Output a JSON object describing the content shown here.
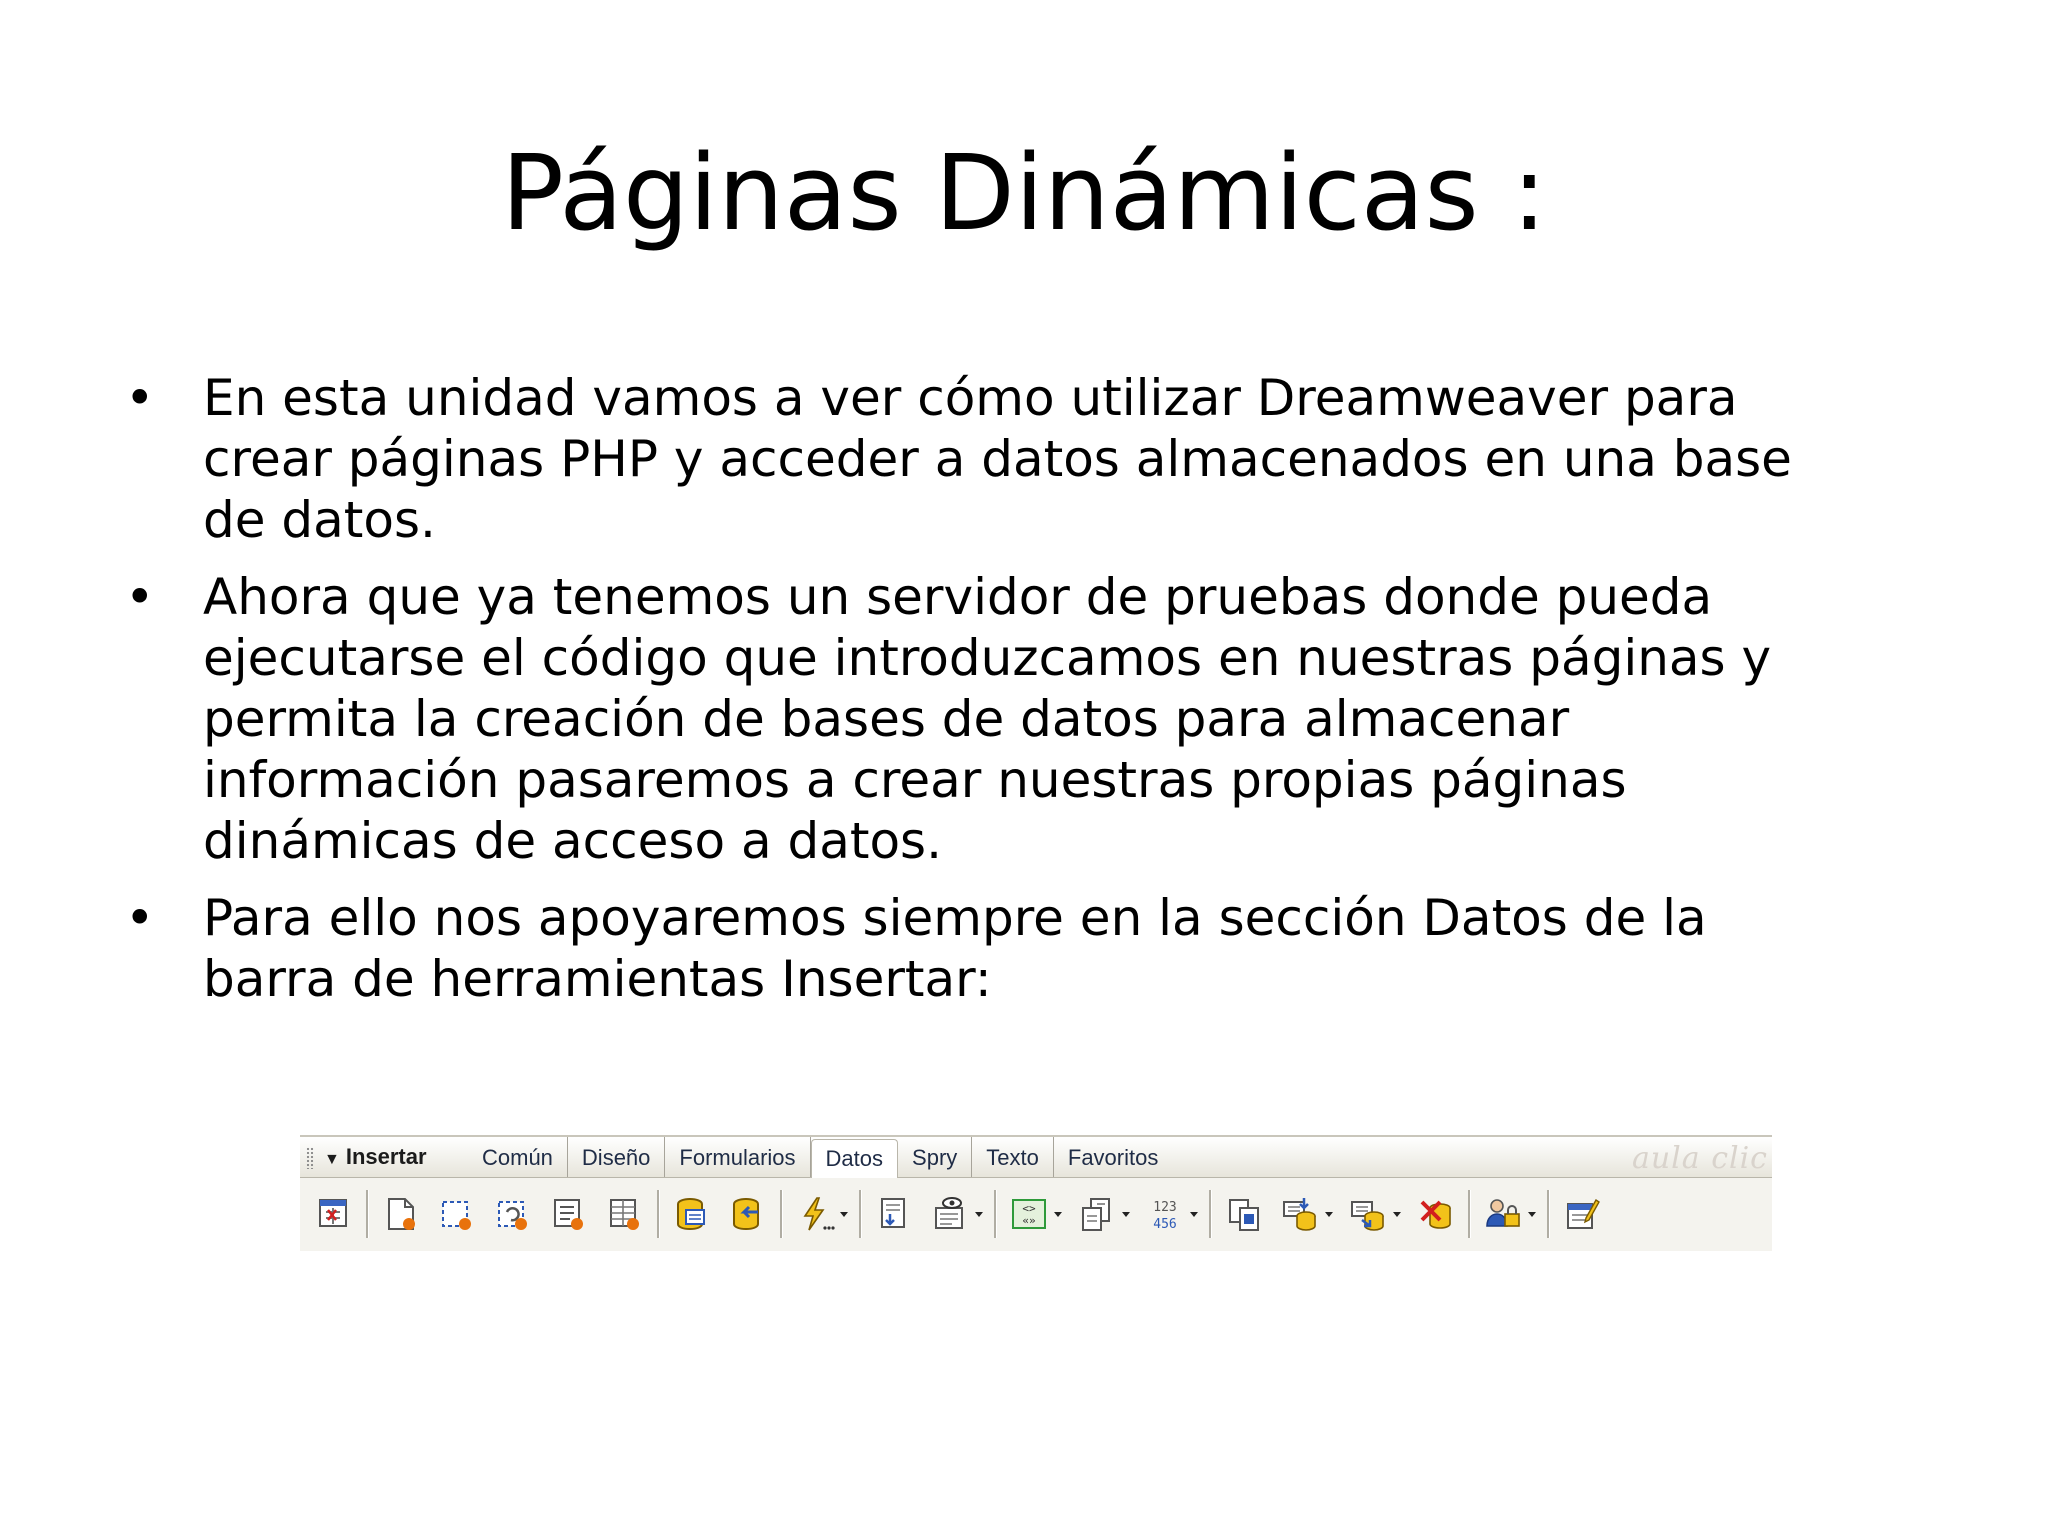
{
  "slide": {
    "title": "Páginas Dinámicas :",
    "bullet_symbol": "•",
    "bullets": [
      "En esta unidad vamos a ver cómo utilizar Dreamweaver para crear páginas PHP y acceder a datos almacenados en una base de datos.",
      "Ahora que ya tenemos un servidor de pruebas donde pueda ejecutarse el código que introduzcamos en nuestras páginas y permita la creación de bases de datos para almacenar información pasaremos a crear nuestras propias páginas dinámicas de acceso a datos.",
      "Para ello nos apoyaremos siempre en la sección Datos de la barra de herramientas Insertar:"
    ]
  },
  "toolbar": {
    "menu_label": "Insertar",
    "menu_arrow": "▼",
    "tabs": [
      {
        "label": "Común",
        "active": false
      },
      {
        "label": "Diseño",
        "active": false
      },
      {
        "label": "Formularios",
        "active": false
      },
      {
        "label": "Datos",
        "active": true
      },
      {
        "label": "Spry",
        "active": false
      },
      {
        "label": "Texto",
        "active": false
      },
      {
        "label": "Favoritos",
        "active": false
      }
    ],
    "watermark": "aula clic",
    "icons": [
      "import-tabular-data-icon",
      "spry-dataset-icon",
      "spry-region-icon",
      "spry-repeat-icon",
      "spry-repeat-list-icon",
      "spry-table-icon",
      "recordset-icon",
      "stored-procedure-icon",
      "dynamic-data-icon",
      "repeated-region-icon",
      "show-region-icon",
      "recordset-paging-icon",
      "go-to-detail-page-icon",
      "display-record-count-icon",
      "master-detail-page-set-icon",
      "insert-record-icon",
      "update-record-icon",
      "delete-record-icon",
      "user-authentication-icon",
      "xslt-transformation-icon"
    ],
    "counter_digits": "123 456",
    "colors": {
      "orange": "#e8720c",
      "blue": "#2c59b6",
      "yellow": "#f2c21a",
      "green": "#2e9a3a",
      "red": "#d21f1f"
    }
  }
}
